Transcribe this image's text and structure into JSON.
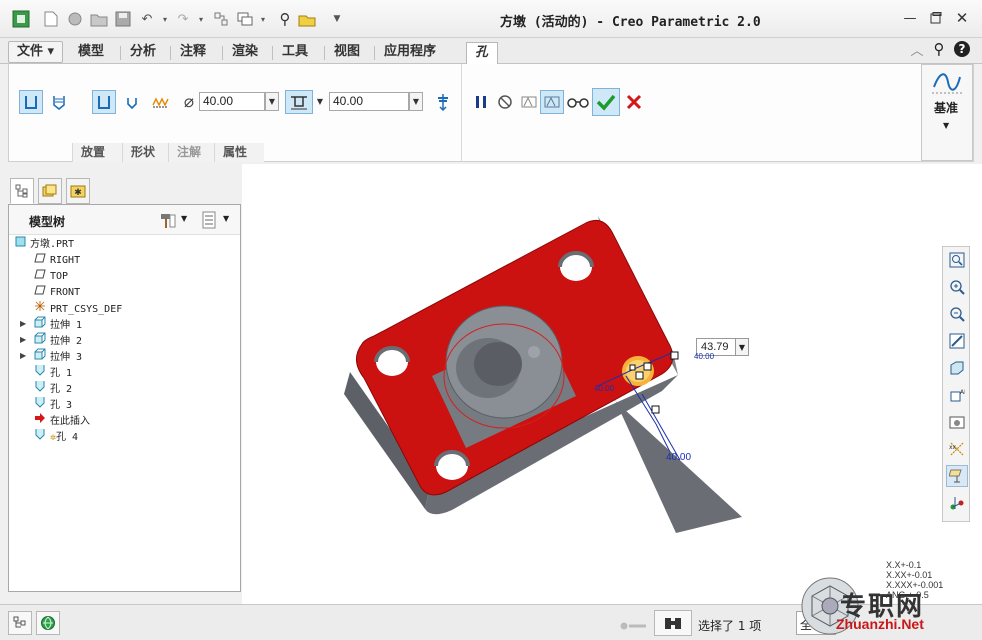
{
  "window": {
    "title": "方墩 (活动的) - Creo Parametric 2.0"
  },
  "menu_tabs": [
    {
      "label": "文件 ▾"
    },
    {
      "label": "模型"
    },
    {
      "label": "分析"
    },
    {
      "label": "注释"
    },
    {
      "label": "渲染"
    },
    {
      "label": "工具"
    },
    {
      "label": "视图"
    },
    {
      "label": "应用程序"
    },
    {
      "label": "孔"
    }
  ],
  "ribbon": {
    "diameter_value": "40.00",
    "depth_value": "40.00",
    "subtabs": [
      "放置",
      "形状",
      "注解",
      "属性"
    ],
    "datum_label": "基准"
  },
  "model_tree": {
    "title": "模型树",
    "items": [
      {
        "label": "方墩.PRT",
        "icon": "part-icon"
      },
      {
        "label": "RIGHT",
        "icon": "datum-plane-icon"
      },
      {
        "label": "TOP",
        "icon": "datum-plane-icon"
      },
      {
        "label": "FRONT",
        "icon": "datum-plane-icon"
      },
      {
        "label": "PRT_CSYS_DEF",
        "icon": "csys-icon"
      },
      {
        "label": "拉伸 1",
        "icon": "extrude-icon"
      },
      {
        "label": "拉伸 2",
        "icon": "extrude-icon"
      },
      {
        "label": "拉伸 3",
        "icon": "extrude-icon"
      },
      {
        "label": "孔 1",
        "icon": "hole-icon"
      },
      {
        "label": "孔 2",
        "icon": "hole-icon"
      },
      {
        "label": "孔 3",
        "icon": "hole-icon"
      },
      {
        "label": "在此插入",
        "icon": "insert-arrow-icon"
      },
      {
        "label": "孔 4",
        "icon": "hole-icon"
      }
    ]
  },
  "canvas": {
    "dim_field_value": "43.79",
    "dim_label_depth": "40.00",
    "dim_label_offset": "40.00",
    "dim_label_side": "40.00"
  },
  "tolerance_display": {
    "lines": [
      "X.X+-0.1",
      "X.XX+-0.01",
      "X.XXX+-0.001",
      "ANG.+-0.5"
    ]
  },
  "statusbar": {
    "selection_text": "选择了 1 项",
    "filter_value": "全"
  },
  "watermark": {
    "cn": "专职网",
    "url": "Zhuanzhi.Net"
  },
  "colors": {
    "part_red": "#cc1111",
    "part_gray": "#7a7f86",
    "accent_blue": "#1a6bb8",
    "dim_blue": "#1a2fb0"
  }
}
